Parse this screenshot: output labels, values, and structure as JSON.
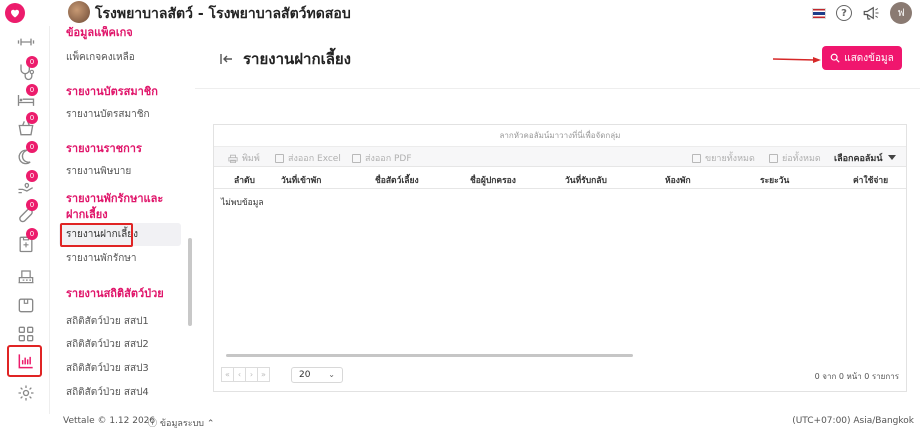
{
  "header": {
    "hospital_name": "โรงพยาบาลสัตว์ - โรงพยาบาลสัตว์ทดสอบ",
    "user_initial": "ฟ"
  },
  "submenu": {
    "items": [
      {
        "type": "head",
        "label": "ข้อมูลแพ็คเกจ"
      },
      {
        "type": "item",
        "label": "แพ็คเกจคงเหลือ"
      },
      {
        "type": "head",
        "label": "รายงานบัตรสมาชิก"
      },
      {
        "type": "item",
        "label": "รายงานบัตรสมาชิก"
      },
      {
        "type": "head",
        "label": "รายงานราชการ"
      },
      {
        "type": "item",
        "label": "รายงานพิษบาย"
      },
      {
        "type": "head",
        "label": "รายงานพักรักษาและ"
      },
      {
        "type": "head",
        "label": "ฝากเลี้ยง"
      },
      {
        "type": "item",
        "label": "รายงานฝากเลี้ยง",
        "active": true
      },
      {
        "type": "item",
        "label": "รายงานพักรักษา"
      },
      {
        "type": "head",
        "label": "รายงานสถิติสัตว์ป่วย"
      },
      {
        "type": "item",
        "label": "สถิติสัตว์ป่วย สสป1"
      },
      {
        "type": "item",
        "label": "สถิติสัตว์ป่วย สสป2"
      },
      {
        "type": "item",
        "label": "สถิติสัตว์ป่วย สสป3"
      },
      {
        "type": "item",
        "label": "สถิติสัตว์ป่วย สสป4"
      }
    ]
  },
  "main": {
    "title": "รายงานฝากเลี้ยง",
    "show_button": "แสดงข้อมูล"
  },
  "grid": {
    "group_panel": "ลากหัวคอลัมน์มาวางที่นี่เพื่อจัดกลุ่ม",
    "toolbar": {
      "print": "พิมพ์",
      "export_excel": "ส่งออก Excel",
      "export_pdf": "ส่งออก PDF",
      "expand_all": "ขยายทั้งหมด",
      "collapse_all": "ย่อทั้งหมด",
      "choose_columns": "เลือกคอลัมน์"
    },
    "columns": [
      "ลำดับ",
      "วันที่เข้าพัก",
      "ชื่อสัตว์เลี้ยง",
      "ชื่อผู้ปกครอง",
      "วันที่รับกลับ",
      "ห้องพัก",
      "ระยะวัน",
      "ค่าใช้จ่าย"
    ],
    "empty_message": "ไม่พบข้อมูล",
    "page_size": "20",
    "page_info": "0 จาก 0 หน้า 0 รายการ"
  },
  "footer": {
    "version": "Vettale © 1.12 2026",
    "system_info": "ข้อมูลระบบ",
    "timezone": "(UTC+07:00) Asia/Bangkok"
  },
  "rail_badges": [
    "0",
    "0",
    "0",
    "0",
    "0",
    "0",
    "0"
  ],
  "colors": {
    "brand": "#ec1c6c",
    "button": "#f0166e",
    "highlight_box": "#e02424"
  }
}
